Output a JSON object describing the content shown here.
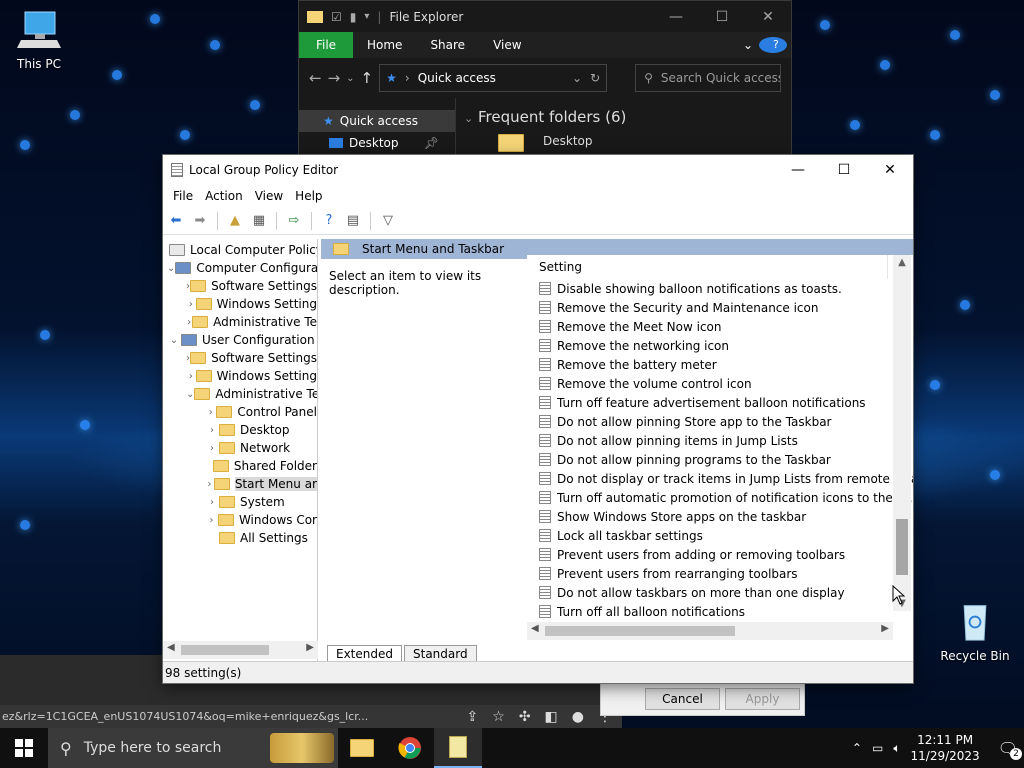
{
  "desktop": {
    "this_pc_label": "This PC",
    "recycle_bin_label": "Recycle Bin"
  },
  "file_explorer": {
    "title": "File Explorer",
    "ribbon": [
      "File",
      "Home",
      "Share",
      "View"
    ],
    "address": "Quick access",
    "search_placeholder": "Search Quick access",
    "quick_access": "Quick access",
    "desktop_item": "Desktop",
    "frequent_folders": "Frequent folders (6)",
    "frequent_desktop": "Desktop"
  },
  "background_dialog": {
    "cancel_label": "Cancel",
    "apply_label": "Apply"
  },
  "browser": {
    "url_text": "ez&rlz=1C1GCEA_enUS1074US1074&oq=mike+enriquez&gs_lcr..."
  },
  "gpedit": {
    "title": "Local Group Policy Editor",
    "menu": [
      "File",
      "Action",
      "View",
      "Help"
    ],
    "tree": [
      {
        "label": "Local Computer Policy",
        "indent": 0,
        "arrow": ""
      },
      {
        "label": "Computer Configura",
        "indent": 1,
        "arrow": "v"
      },
      {
        "label": "Software Settings",
        "indent": 2,
        "arrow": ">"
      },
      {
        "label": "Windows Setting",
        "indent": 2,
        "arrow": ">"
      },
      {
        "label": "Administrative Te",
        "indent": 2,
        "arrow": ">"
      },
      {
        "label": "User Configuration",
        "indent": 1,
        "arrow": "v"
      },
      {
        "label": "Software Settings",
        "indent": 2,
        "arrow": ">"
      },
      {
        "label": "Windows Setting",
        "indent": 2,
        "arrow": ">"
      },
      {
        "label": "Administrative Te",
        "indent": 2,
        "arrow": "v"
      },
      {
        "label": "Control Panel",
        "indent": 3,
        "arrow": ">"
      },
      {
        "label": "Desktop",
        "indent": 3,
        "arrow": ">"
      },
      {
        "label": "Network",
        "indent": 3,
        "arrow": ">"
      },
      {
        "label": "Shared Folder",
        "indent": 3,
        "arrow": ""
      },
      {
        "label": "Start Menu ar",
        "indent": 3,
        "arrow": ">",
        "selected": true
      },
      {
        "label": "System",
        "indent": 3,
        "arrow": ">"
      },
      {
        "label": "Windows Cor",
        "indent": 3,
        "arrow": ">"
      },
      {
        "label": "All Settings",
        "indent": 3,
        "arrow": ""
      }
    ],
    "header_folder": "Start Menu and Taskbar",
    "description": "Select an item to view its description.",
    "column_setting": "Setting",
    "settings": [
      "Disable showing balloon notifications as toasts.",
      "Remove the Security and Maintenance icon",
      "Remove the Meet Now icon",
      "Remove the networking icon",
      "Remove the battery meter",
      "Remove the volume control icon",
      "Turn off feature advertisement balloon notifications",
      "Do not allow pinning Store app to the Taskbar",
      "Do not allow pinning items in Jump Lists",
      "Do not allow pinning programs to the Taskbar",
      "Do not display or track items in Jump Lists from remote loca...",
      "Turn off automatic promotion of notification icons to the ta...",
      "Show Windows Store apps on the taskbar",
      "Lock all taskbar settings",
      "Prevent users from adding or removing toolbars",
      "Prevent users from rearranging toolbars",
      "Do not allow taskbars on more than one display",
      "Turn off all balloon notifications"
    ],
    "tabs": [
      "Extended",
      "Standard"
    ],
    "status": "98 setting(s)"
  },
  "taskbar": {
    "search_placeholder": "Type here to search",
    "time": "12:11 PM",
    "date": "11/29/2023",
    "notification_count": "2"
  },
  "colors": {
    "accent_blue": "#2d8cff",
    "file_tab_green": "#1e9a3a",
    "header_band": "#9fb5d6"
  }
}
